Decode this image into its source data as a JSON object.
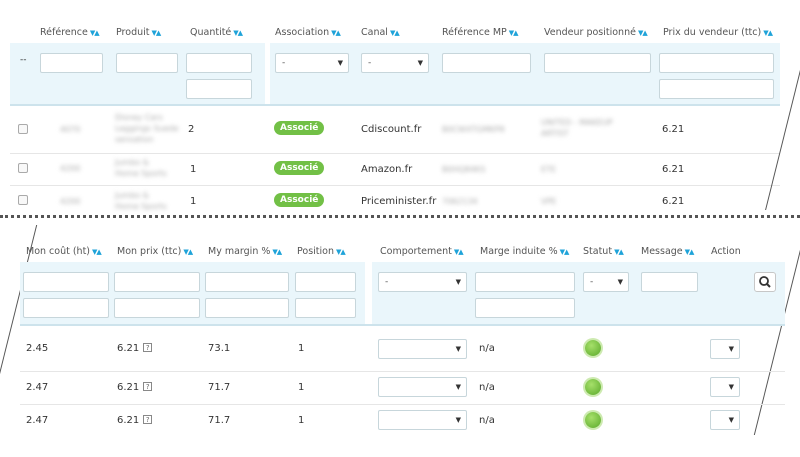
{
  "top": {
    "headers": {
      "reference": "Référence",
      "produit": "Produit",
      "quantite": "Quantité",
      "association": "Association",
      "canal": "Canal",
      "reference_mp": "Référence MP",
      "vendeur": "Vendeur positionné",
      "prix_vendeur": "Prix du vendeur (ttc)"
    },
    "filter_reference_value": "--",
    "association_select": "-",
    "canal_select": "-",
    "rows": [
      {
        "quantite": "2",
        "association": "Associé",
        "canal": "Cdiscount.fr",
        "prix": "6.21"
      },
      {
        "quantite": "1",
        "association": "Associé",
        "canal": "Amazon.fr",
        "prix": "6.21"
      },
      {
        "quantite": "1",
        "association": "Associé",
        "canal": "Priceminister.fr",
        "prix": "6.21"
      }
    ]
  },
  "bottom": {
    "headers": {
      "mon_cout": "Mon coût (ht)",
      "mon_prix": "Mon prix (ttc)",
      "my_margin": "My margin %",
      "position": "Position",
      "comportement": "Comportement",
      "marge_induite": "Marge induite %",
      "statut": "Statut",
      "message": "Message",
      "action": "Action"
    },
    "comportement_select": "-",
    "statut_select": "-",
    "help_glyph": "?",
    "rows": [
      {
        "cout": "2.45",
        "prix": "6.21",
        "margin": "73.1",
        "position": "1",
        "marge_induite": "n/a",
        "status": "green"
      },
      {
        "cout": "2.47",
        "prix": "6.21",
        "margin": "71.7",
        "position": "1",
        "marge_induite": "n/a",
        "status": "green"
      },
      {
        "cout": "2.47",
        "prix": "6.21",
        "margin": "71.7",
        "position": "1",
        "marge_induite": "n/a",
        "status": "green"
      }
    ]
  },
  "icons": {
    "sort": "sort-arrows-icon",
    "search": "search-icon",
    "caret": "caret-down-icon",
    "status": "status-ok-icon"
  },
  "colors": {
    "sort_arrow": "#1fa3d9",
    "badge_green": "#72c046",
    "filter_band": "#eaf6fb"
  }
}
